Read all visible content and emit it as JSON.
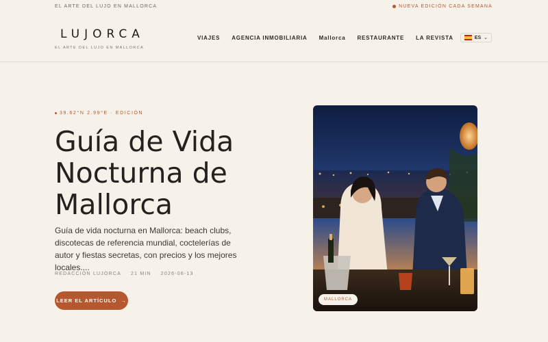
{
  "topbar": {
    "tagline": "EL ARTE DEL LUJO EN MALLORCA",
    "announcement": "NUEVA EDICIÓN CADA SEMANA"
  },
  "header": {
    "logo": "LUJORCA",
    "logo_sub": "EL ARTE DEL LUJO EN MALLORCA",
    "nav": [
      "VIAJES",
      "AGENCIA INMOBILIARIA",
      "Mallorca",
      "RESTAURANTE",
      "LA REVISTA"
    ],
    "language": "ES",
    "language_flag_icon": "spain-flag-icon"
  },
  "hero": {
    "kicker": "39.62°N 2.99°E · EDICIÓN",
    "title": "Guía de Vida Nocturna de Mallorca",
    "description": "Guía de vida nocturna en Mallorca: beach clubs, discotecas de referencia mundial, coctelerías de autor y fiestas secretas, con precios y los mejores locales....",
    "author": "REDACCIÓN LUJORCA",
    "read_time": "21 MIN",
    "date": "2026-06-13",
    "cta_label": "LEER EL ARTÍCULO",
    "cta_arrow": "→"
  },
  "image": {
    "badge": "MALLORCA"
  },
  "colors": {
    "accent": "#b5582f",
    "background": "#f6f2ea"
  }
}
